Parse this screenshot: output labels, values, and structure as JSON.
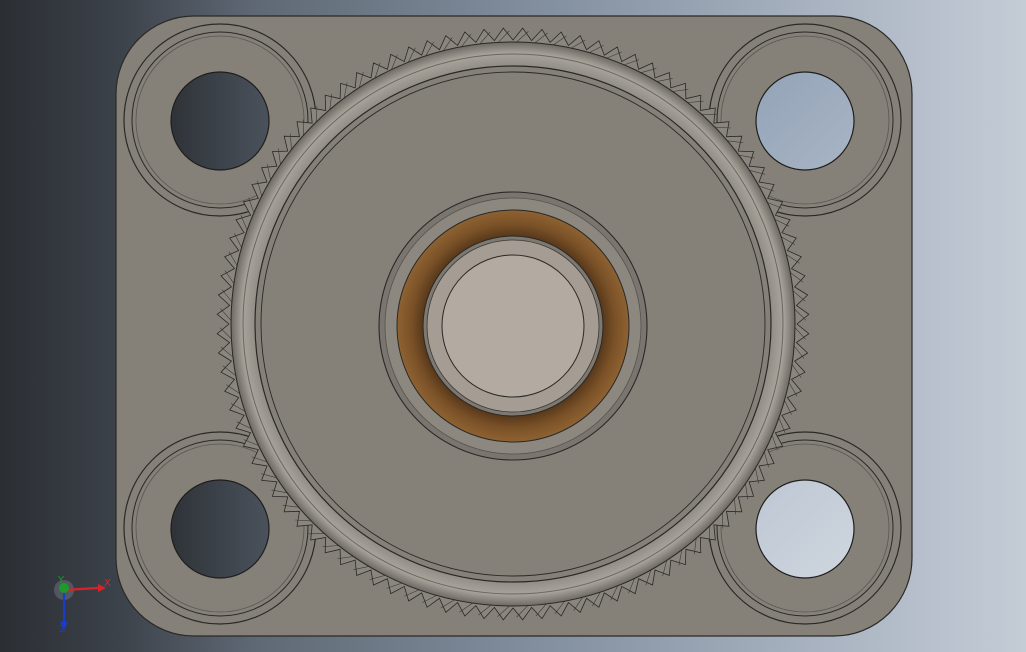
{
  "view": {
    "part": "square-flange-with-knurled-nut",
    "colors": {
      "background_dark": "#2b2e33",
      "background_light": "#c4ccd6",
      "part_face": "#858179",
      "part_edge": "#2a2926",
      "bronze_bushing": "#7a5127",
      "shaft_face": "#b3aaa2"
    }
  },
  "triad": {
    "x_label": "X",
    "y_label": "Y",
    "z_label": "Z",
    "colors": {
      "x": "#d8232a",
      "y": "#1d9a2b",
      "z": "#1b3cc9"
    }
  }
}
